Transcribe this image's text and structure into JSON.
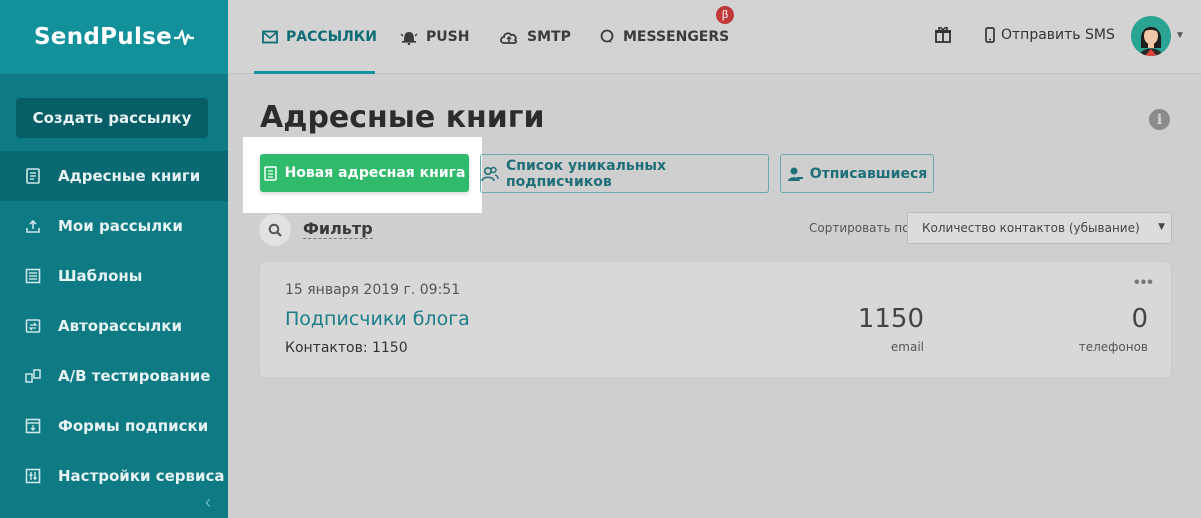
{
  "brand": {
    "name": "SendPulse"
  },
  "sidebar": {
    "create_button": "Создать рассылку",
    "items": [
      {
        "label": "Адресные книги",
        "icon": "address-book-icon",
        "active": true
      },
      {
        "label": "Мои рассылки",
        "icon": "upload-tray-icon",
        "active": false
      },
      {
        "label": "Шаблоны",
        "icon": "template-icon",
        "active": false
      },
      {
        "label": "Авторассылки",
        "icon": "autoresponder-icon",
        "active": false
      },
      {
        "label": "A/B тестирование",
        "icon": "ab-test-icon",
        "active": false
      },
      {
        "label": "Формы подписки",
        "icon": "subscription-form-icon",
        "active": false
      },
      {
        "label": "Настройки сервиса",
        "icon": "settings-sliders-icon",
        "active": false
      }
    ],
    "collapse_glyph": "‹"
  },
  "topbar": {
    "tabs": [
      {
        "label": "РАССЫЛКИ",
        "icon": "envelope-icon",
        "active": true
      },
      {
        "label": "PUSH",
        "icon": "bell-icon",
        "active": false
      },
      {
        "label": "SMTP",
        "icon": "cloud-upload-icon",
        "active": false
      },
      {
        "label": "MESSENGERS",
        "icon": "chat-bubble-icon",
        "active": false
      }
    ],
    "beta_badge": "β",
    "sms_label": "Отправить SMS"
  },
  "main": {
    "title": "Адресные книги",
    "buttons": {
      "new_book": "Новая адресная книга",
      "unique_subscribers": "Список уникальных подписчиков",
      "unsubscribed": "Отписавшиеся"
    },
    "filter_label": "Фильтр",
    "sort_label": "Сортировать по",
    "sort_value": "Количество контактов (убывание)"
  },
  "books": [
    {
      "date": "15 января 2019 г. 09:51",
      "name": "Подписчики блога",
      "contacts_label": "Контактов: 1150",
      "email_count": "1150",
      "email_label": "email",
      "phone_count": "0",
      "phone_label": "телефонов",
      "menu_glyph": "•••"
    }
  ],
  "colors": {
    "sidebar": "#0d7a84",
    "brand_bg": "#12919b",
    "accent_green": "#2fba6c",
    "link_teal": "#1c7e88"
  }
}
